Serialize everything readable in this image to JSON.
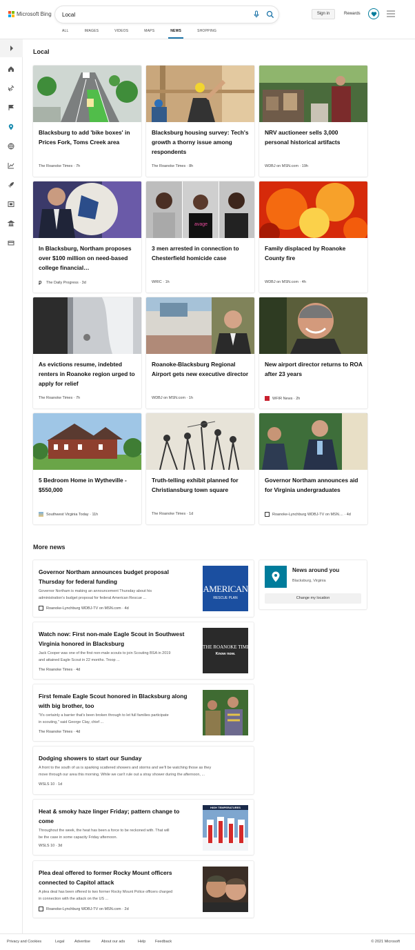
{
  "brand": {
    "name": "Microsoft Bing",
    "colors": [
      "#f35325",
      "#81bc06",
      "#05a6f0",
      "#ffba08"
    ]
  },
  "search": {
    "query": "Local"
  },
  "header": {
    "signin": "Sign in",
    "rewards": "Rewards"
  },
  "tabs": [
    {
      "label": "ALL"
    },
    {
      "label": "IMAGES"
    },
    {
      "label": "VIDEOS"
    },
    {
      "label": "MAPS"
    },
    {
      "label": "NEWS",
      "active": true
    },
    {
      "label": "SHOPPING"
    }
  ],
  "rail": {
    "icons": [
      "chevron-right-icon",
      "home-icon",
      "satellite-icon",
      "flag-icon",
      "location-pin-icon",
      "globe-icon",
      "chart-icon",
      "rocket-icon",
      "film-icon",
      "bank-icon",
      "card-icon"
    ]
  },
  "local": {
    "title": "Local",
    "cards": [
      {
        "title": "Blacksburg to add 'bike boxes' in Prices Fork, Toms Creek area",
        "source": "The Roanoke Times",
        "time": "7h"
      },
      {
        "title": "Blacksburg housing survey: Tech's growth a thorny issue among respondents",
        "source": "The Roanoke Times",
        "time": "8h"
      },
      {
        "title": "NRV auctioneer sells 3,000 personal historical artifacts",
        "source": "WDBJ on MSN.com",
        "time": "19h"
      },
      {
        "title": "In Blacksburg, Northam proposes over $100 million on need-based college financial…",
        "source": "The Daily Progress",
        "time": "3d"
      },
      {
        "title": "3 men arrested in connection to Chesterfield homicide case",
        "source": "WRIC",
        "time": "1h"
      },
      {
        "title": "Family displaced by Roanoke County fire",
        "source": "WDBJ on MSN.com",
        "time": "4h"
      },
      {
        "title": "As evictions resume, indebted renters in Roanoke region urged to apply for relief",
        "source": "The Roanoke Times",
        "time": "7h"
      },
      {
        "title": "Roanoke-Blacksburg Regional Airport gets new executive director",
        "source": "WDBJ on MSN.com",
        "time": "1h"
      },
      {
        "title": "New airport director returns to ROA after 23 years",
        "source": "WFIR News",
        "time": "2h"
      },
      {
        "title": "5 Bedroom Home in Wytheville - $550,000",
        "source": "Southwest Virginia Today",
        "time": "11h"
      },
      {
        "title": "Truth-telling exhibit planned for Christiansburg town square",
        "source": "The Roanoke Times",
        "time": "1d"
      },
      {
        "title": "Governor Northam announces aid for Virginia undergraduates",
        "source": "Roanoke-Lynchburg WDBJ-TV on MSN....",
        "time": "4d"
      }
    ]
  },
  "more": {
    "title": "More news",
    "items": [
      {
        "title_lines": [
          "Governor Northam announces budget proposal",
          "Thursday for federal funding"
        ],
        "snippet_lines": [
          "Governor Northam is making an announcement Thursday about his",
          "administration's budget proposal for federal American Rescue ..."
        ],
        "source": "Roanoke-Lynchburg WDBJ-TV on MSN.com",
        "time": "4d",
        "thumb_text": [
          "AMERICAN",
          "RESCUE PLAN"
        ]
      },
      {
        "title_lines": [
          "Watch now: First non-male Eagle Scout in Southwest",
          "Virginia honored in Blacksburg"
        ],
        "snippet_lines": [
          "Jack Cooper was one of the first non-male scouts to join Scouting BSA in 2019",
          "and attained Eagle Scout in 22 months. Troop ..."
        ],
        "source": "The Roanoke Times",
        "time": "4d",
        "thumb_text": [
          "THE ROANOKE TIMES",
          "Know now."
        ]
      },
      {
        "title_lines": [
          "First female Eagle Scout honored in Blacksburg along",
          "with big brother, too"
        ],
        "snippet_lines": [
          "\"It's certainly a barrier that's been broken through to let full families participate",
          "in scouting,\" said George Clay, chief ..."
        ],
        "source": "The Roanoke Times",
        "time": "4d"
      },
      {
        "title_lines": [
          "Dodging showers to start our Sunday"
        ],
        "snippet_lines": [
          "A front to the south of us is sparking scattered showers and storms and we'll be watching those as they",
          "move through our area this morning. While we can't rule out a stray shower during the afternoon, ..."
        ],
        "source": "WSLS 10",
        "time": "1d"
      },
      {
        "title_lines": [
          "Heat & smoky haze linger Friday; pattern change to",
          "come"
        ],
        "snippet_lines": [
          "Throughout the week, the heat has been a force to be reckoned with. That will",
          "be the case in some capacity Friday afternoon."
        ],
        "source": "WSLS 10",
        "time": "3d",
        "thumb_text": [
          "HIGH TEMPERATURES"
        ]
      },
      {
        "title_lines": [
          "Plea deal offered to former Rocky Mount officers",
          "connected to Capitol attack"
        ],
        "snippet_lines": [
          "A plea deal has been offered to two former Rocky Mount Police officers charged",
          "in connection with the attack on the US ..."
        ],
        "source": "Roanoke-Lynchburg WDBJ-TV on MSN.com",
        "time": "2d"
      }
    ]
  },
  "around": {
    "title": "News around you",
    "location": "Blacksburg, Virginia",
    "button": "Change my location"
  },
  "footer": {
    "links": [
      "Privacy and Cookies",
      "Legal",
      "Advertise",
      "About our ads",
      "Help",
      "Feedback"
    ],
    "copyright": "© 2021 Microsoft"
  }
}
